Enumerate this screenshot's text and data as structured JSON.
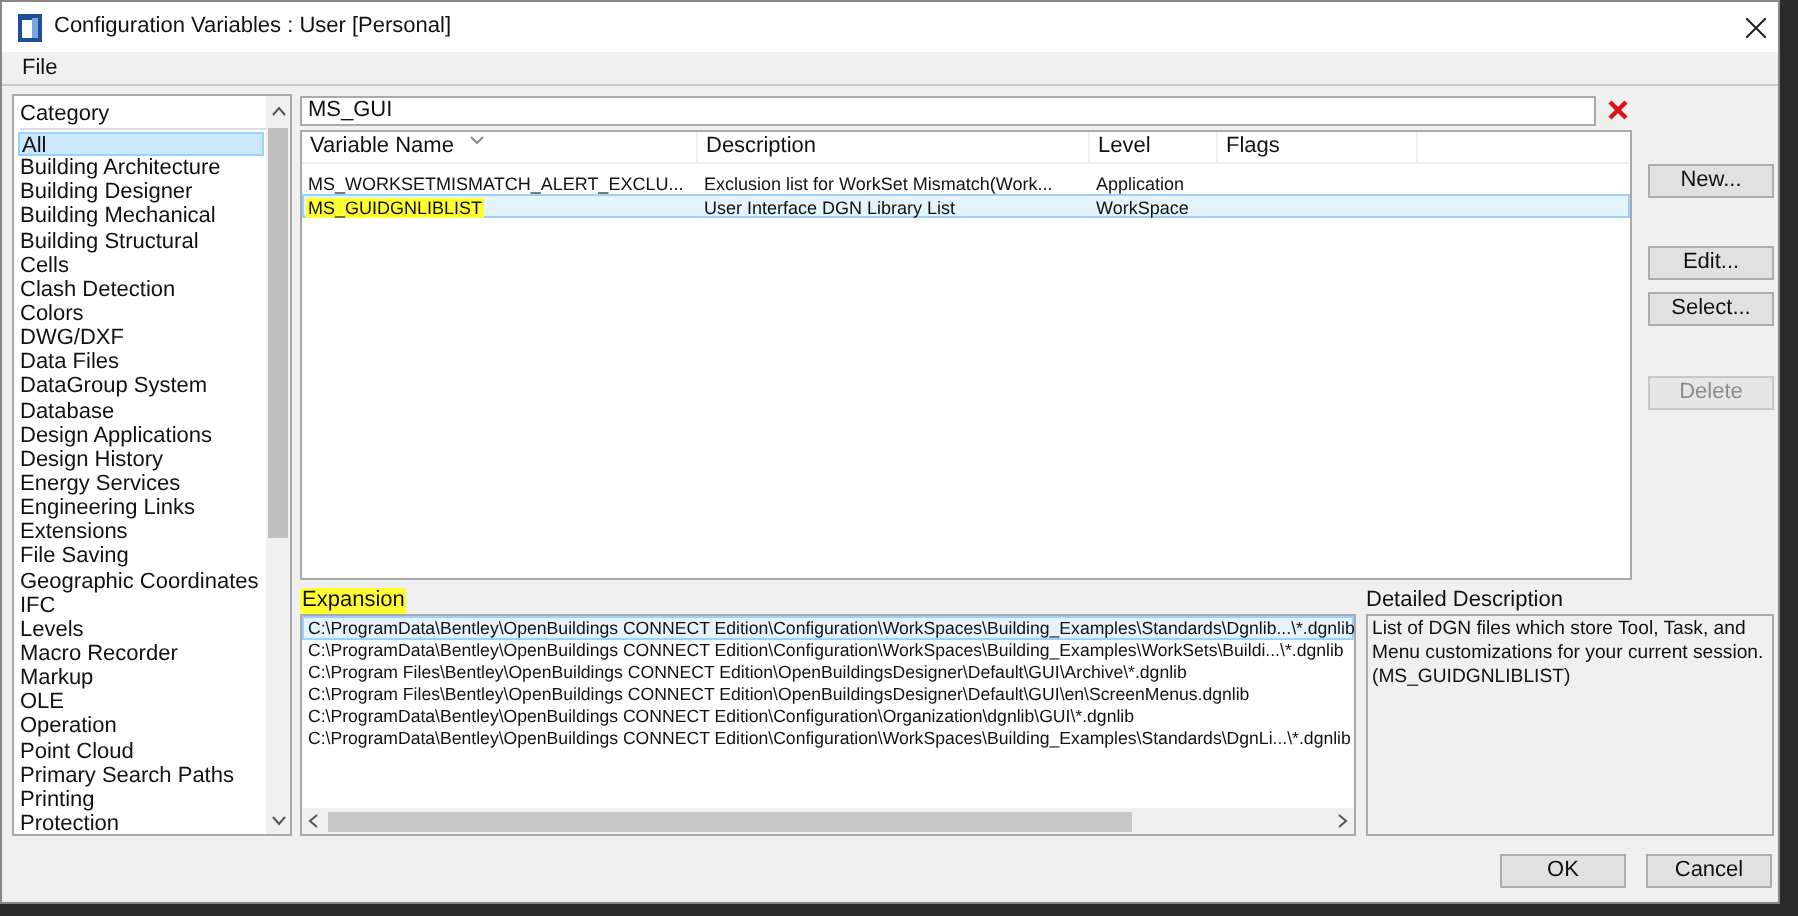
{
  "window": {
    "title": "Configuration Variables : User [Personal]"
  },
  "menu": [
    "File"
  ],
  "category_list": {
    "header": "Category",
    "items": [
      {
        "label": "All",
        "selected": true
      },
      {
        "label": "Building Architecture",
        "selected": false
      },
      {
        "label": "Building Designer",
        "selected": false
      },
      {
        "label": "Building Mechanical",
        "selected": false
      },
      {
        "label": "Building Structural",
        "selected": false
      },
      {
        "label": "Cells",
        "selected": false
      },
      {
        "label": "Clash Detection",
        "selected": false
      },
      {
        "label": "Colors",
        "selected": false
      },
      {
        "label": "DWG/DXF",
        "selected": false
      },
      {
        "label": "Data Files",
        "selected": false
      },
      {
        "label": "DataGroup System",
        "selected": false
      },
      {
        "label": "Database",
        "selected": false
      },
      {
        "label": "Design Applications",
        "selected": false
      },
      {
        "label": "Design History",
        "selected": false
      },
      {
        "label": "Energy Services",
        "selected": false
      },
      {
        "label": "Engineering Links",
        "selected": false
      },
      {
        "label": "Extensions",
        "selected": false
      },
      {
        "label": "File Saving",
        "selected": false
      },
      {
        "label": "Geographic Coordinates",
        "selected": false
      },
      {
        "label": "IFC",
        "selected": false
      },
      {
        "label": "Levels",
        "selected": false
      },
      {
        "label": "Macro Recorder",
        "selected": false
      },
      {
        "label": "Markup",
        "selected": false
      },
      {
        "label": "OLE",
        "selected": false
      },
      {
        "label": "Operation",
        "selected": false
      },
      {
        "label": "Point Cloud",
        "selected": false
      },
      {
        "label": "Primary Search Paths",
        "selected": false
      },
      {
        "label": "Printing",
        "selected": false
      },
      {
        "label": "Protection",
        "selected": false
      }
    ]
  },
  "search": {
    "value": "MS_GUI"
  },
  "variables_table": {
    "columns": [
      "Variable Name",
      "Description",
      "Level",
      "Flags"
    ],
    "rows": [
      {
        "cells": [
          "MS_WORKSETMISMATCH_ALERT_EXCLU...",
          "Exclusion list for WorkSet Mismatch(Work...",
          "Application"
        ],
        "selected": false,
        "highlighted": false
      },
      {
        "cells": [
          "MS_GUIDGNLIBLIST",
          "User Interface DGN Library List",
          "WorkSpace"
        ],
        "selected": true,
        "highlighted": true
      }
    ]
  },
  "side_buttons": [
    {
      "label": "New...",
      "disabled": false
    },
    {
      "label": "Edit...",
      "disabled": false
    },
    {
      "label": "Select...",
      "disabled": false
    },
    {
      "label": "Delete",
      "disabled": true
    }
  ],
  "expansion": {
    "label": "Expansion",
    "highlighted": true,
    "rows": [
      {
        "text": "C:\\ProgramData\\Bentley\\OpenBuildings CONNECT Edition\\Configuration\\WorkSpaces\\Building_Examples\\Standards\\Dgnlib...\\*.dgnlib",
        "selected": true
      },
      {
        "text": "C:\\ProgramData\\Bentley\\OpenBuildings CONNECT Edition\\Configuration\\WorkSpaces\\Building_Examples\\WorkSets\\Buildi...\\*.dgnlib",
        "selected": false
      },
      {
        "text": "C:\\Program Files\\Bentley\\OpenBuildings CONNECT Edition\\OpenBuildingsDesigner\\Default\\GUI\\Archive\\*.dgnlib",
        "selected": false
      },
      {
        "text": "C:\\Program Files\\Bentley\\OpenBuildings CONNECT Edition\\OpenBuildingsDesigner\\Default\\GUI\\en\\ScreenMenus.dgnlib",
        "selected": false
      },
      {
        "text": "C:\\ProgramData\\Bentley\\OpenBuildings CONNECT Edition\\Configuration\\Organization\\dgnlib\\GUI\\*.dgnlib",
        "selected": false
      },
      {
        "text": "C:\\ProgramData\\Bentley\\OpenBuildings CONNECT Edition\\Configuration\\WorkSpaces\\Building_Examples\\Standards\\DgnLi...\\*.dgnlib",
        "selected": false
      }
    ]
  },
  "detailed_description": {
    "label": "Detailed Description",
    "text": "List of DGN files which store Tool, Task, and Menu customizations for your current session. (MS_GUIDGNLIBLIST)"
  },
  "footer_buttons": [
    "OK",
    "Cancel"
  ]
}
